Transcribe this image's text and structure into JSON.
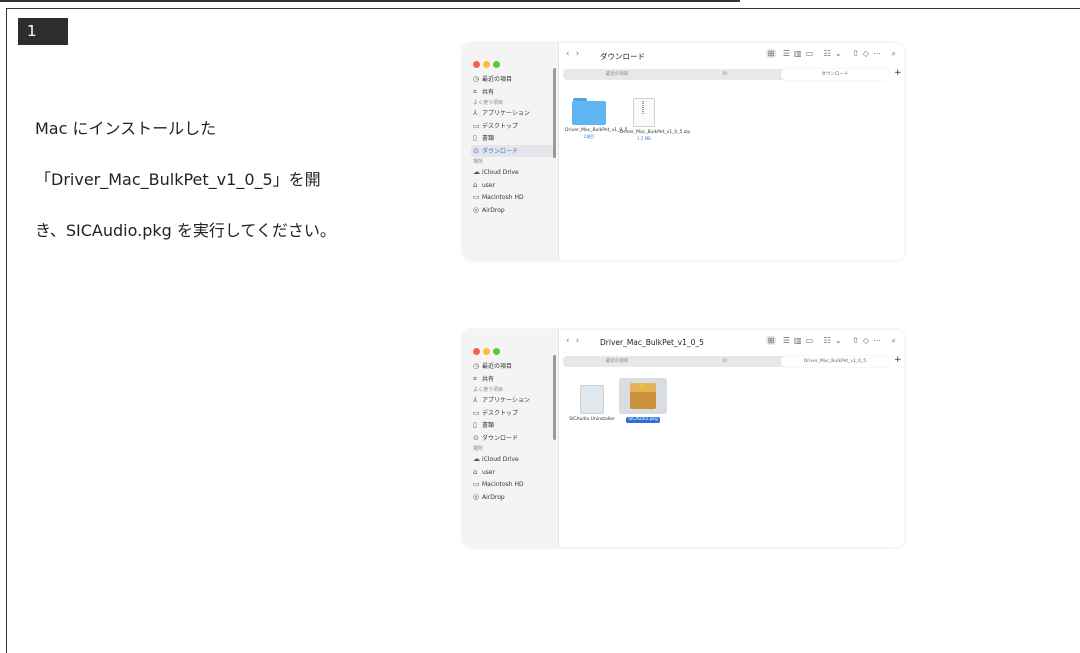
{
  "step": {
    "number": "1"
  },
  "instruction": {
    "line1": "Mac にインストールした",
    "line2": "「Driver_Mac_BulkPet_v1_0_5」を開",
    "line3": "き、SICAudio.pkg を実行してください。"
  },
  "colors": {
    "traffic_red": "#f25f58",
    "traffic_yellow": "#fbbe2e",
    "traffic_green": "#58c83f",
    "accent": "#2f6fd8"
  },
  "sidebar": {
    "items": [
      {
        "icon": "clock-icon",
        "label": "最近の項目"
      },
      {
        "icon": "shared-icon",
        "label": "共有"
      },
      {
        "section": "よく使う項目"
      },
      {
        "icon": "applications-icon",
        "label": "アプリケーション"
      },
      {
        "icon": "desktop-icon",
        "label": "デスクトップ"
      },
      {
        "icon": "document-icon",
        "label": "書類"
      },
      {
        "icon": "download-icon",
        "label": "ダウンロード"
      },
      {
        "section": "場所"
      },
      {
        "icon": "cloud-icon",
        "label": "iCloud Drive"
      },
      {
        "icon": "home-icon",
        "label": "user"
      },
      {
        "icon": "disk-icon",
        "label": "Macintosh HD"
      },
      {
        "icon": "airdrop-icon",
        "label": "AirDrop"
      }
    ]
  },
  "window1": {
    "title": "ダウンロード",
    "tabs": [
      "最近の項目",
      "IR",
      "ダウンロード"
    ],
    "files": [
      {
        "name": "Driver_Mac_BulkPet_v1_0_5",
        "sub": "2項目",
        "icon": "folder-icon"
      },
      {
        "name": "Driver_Mac_BulkPet_v1_0_5.zip",
        "sub": "1.5 MB",
        "icon": "zip-icon"
      }
    ]
  },
  "window2": {
    "title": "Driver_Mac_BulkPet_v1_0_5",
    "tabs": [
      "最近の項目",
      "IR",
      "Driver_Mac_BulkPet_v1_0_5"
    ],
    "files": [
      {
        "name": "SICAudio Uninstaller",
        "icon": "document-icon"
      },
      {
        "name": "SICAudio.pkg",
        "icon": "package-icon"
      }
    ]
  }
}
